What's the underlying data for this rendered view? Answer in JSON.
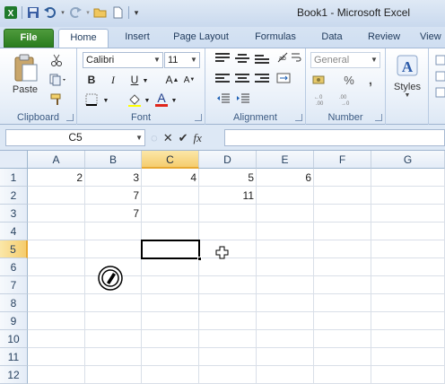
{
  "window": {
    "title": "Book1  -  Microsoft Excel"
  },
  "qat": {
    "icons": [
      "excel-logo-icon",
      "save-icon",
      "undo-icon",
      "redo-icon",
      "open-icon",
      "new-icon",
      "customize-qat-icon"
    ]
  },
  "tabs": [
    {
      "label": "File"
    },
    {
      "label": "Home"
    },
    {
      "label": "Insert"
    },
    {
      "label": "Page Layout"
    },
    {
      "label": "Formulas"
    },
    {
      "label": "Data"
    },
    {
      "label": "Review"
    },
    {
      "label": "View"
    }
  ],
  "ribbon": {
    "clipboard": {
      "label": "Clipboard",
      "paste_label": "Paste"
    },
    "font": {
      "label": "Font",
      "font_name": "Calibri",
      "font_size": "11",
      "bold": "B",
      "italic": "I",
      "underline": "U",
      "grow": "A",
      "shrink": "A",
      "font_color_letter": "A"
    },
    "alignment": {
      "label": "Alignment"
    },
    "number": {
      "label": "Number",
      "format": "General",
      "percent": "%",
      "comma": ","
    },
    "styles": {
      "label": "Styles"
    }
  },
  "formula_bar": {
    "name_box": "C5",
    "fx": "fx",
    "value": ""
  },
  "grid": {
    "columns": [
      "A",
      "B",
      "C",
      "D",
      "E",
      "F",
      "G"
    ],
    "rows": [
      "1",
      "2",
      "3",
      "4",
      "5",
      "6",
      "7",
      "8",
      "9",
      "10",
      "11",
      "12"
    ],
    "selected_column": "C",
    "selected_row": "5",
    "active_cell": "C5",
    "cells": [
      {
        "ref": "A1",
        "value": "2"
      },
      {
        "ref": "B1",
        "value": "3"
      },
      {
        "ref": "C1",
        "value": "4"
      },
      {
        "ref": "D1",
        "value": "5"
      },
      {
        "ref": "E1",
        "value": "6"
      },
      {
        "ref": "B2",
        "value": "7"
      },
      {
        "ref": "D2",
        "value": "11"
      },
      {
        "ref": "B3",
        "value": "7"
      }
    ]
  },
  "colors": {
    "accent": "#2a7d1f",
    "selection_header": "#f5cd6e",
    "ribbon": "#dde8f5"
  }
}
